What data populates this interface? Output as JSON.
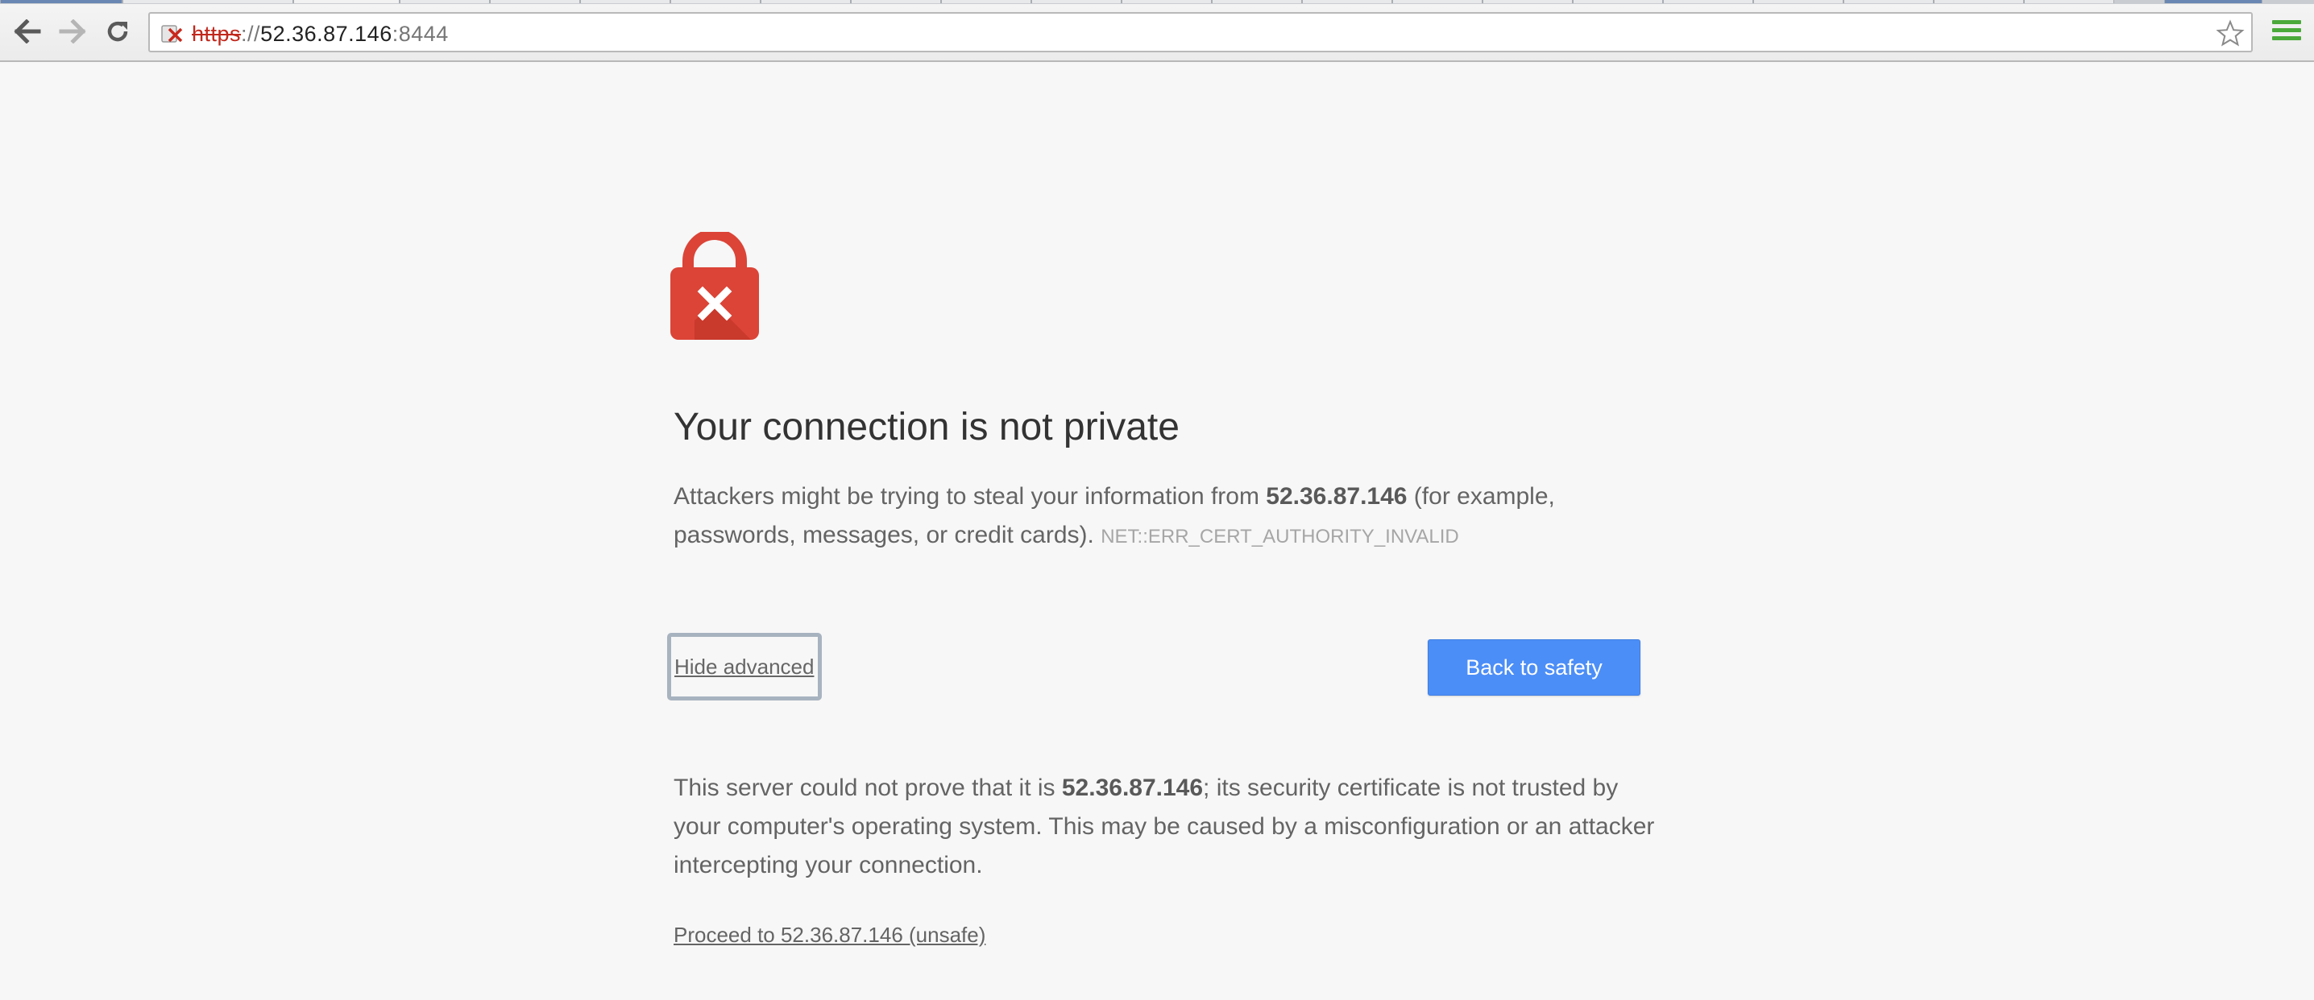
{
  "browser": {
    "url_scheme": "https",
    "url_separator": "://",
    "url_host": "52.36.87.146",
    "url_port": ":8444",
    "menu_color": "#4aa93a"
  },
  "icons": {
    "back": "back-arrow-icon",
    "forward": "forward-arrow-icon",
    "reload": "reload-icon",
    "security": "broken-lock-icon",
    "bookmark": "star-icon",
    "menu": "hamburger-menu-icon",
    "hero": "red-lock-x-icon"
  },
  "interstitial": {
    "heading": "Your connection is not private",
    "p1_before": "Attackers might be trying to steal your information from ",
    "p1_host": "52.36.87.146",
    "p1_after": " (for example, passwords, messages, or credit cards).",
    "error_code": "NET::ERR_CERT_AUTHORITY_INVALID",
    "hide_advanced_label": "Hide advanced",
    "back_to_safety_label": "Back to safety",
    "p2_before": "This server could not prove that it is ",
    "p2_host": "52.36.87.146",
    "p2_after": "; its security certificate is not trusted by your computer's operating system. This may be caused by a misconfiguration or an attacker intercepting your connection.",
    "proceed_label": "Proceed to 52.36.87.146 (unsafe)",
    "accent_color": "#4c8ef7",
    "lock_color": "#db4437"
  }
}
